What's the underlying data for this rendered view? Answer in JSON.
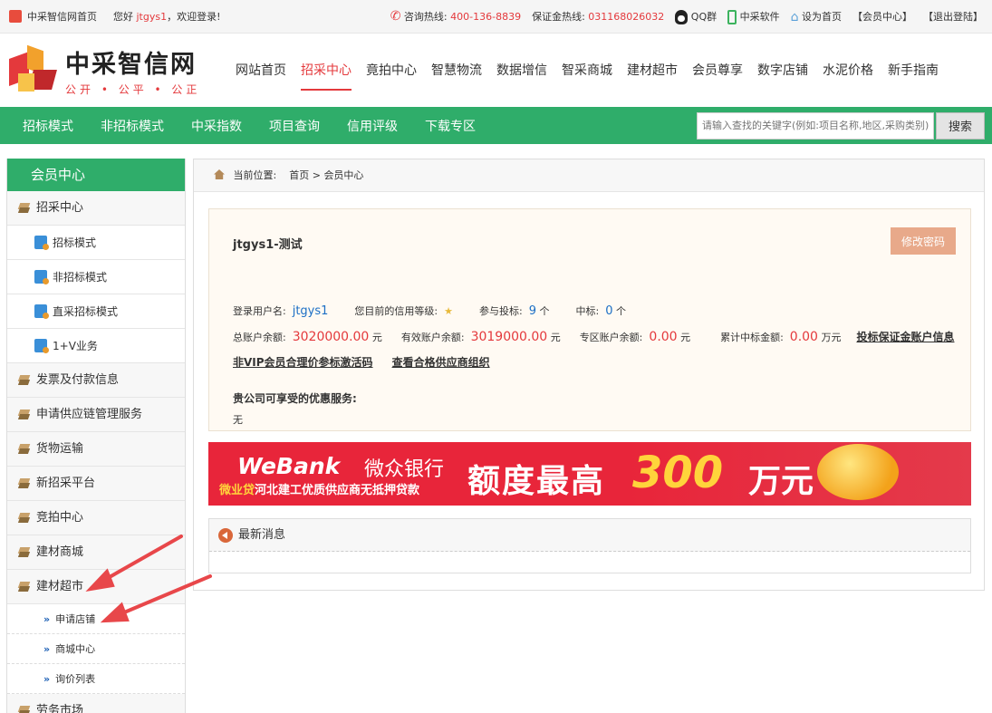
{
  "topbar": {
    "site_home": "中采智信网首页",
    "greet_prefix": "您好",
    "username": "jtgys1",
    "greet_suffix": "，欢迎登录!",
    "hotline_label": "咨询热线:",
    "hotline": "400-136-8839",
    "deposit_label": "保证金热线:",
    "deposit_phone": "031168026032",
    "qq": "QQ群",
    "software": "中采软件",
    "set_home": "设为首页",
    "member_center": "【会员中心】",
    "logout": "【退出登陆】"
  },
  "logo": {
    "name": "中采智信网",
    "slogan": "公开 • 公平 • 公正"
  },
  "mainnav": [
    "网站首页",
    "招采中心",
    "竟拍中心",
    "智慧物流",
    "数据增信",
    "智采商城",
    "建材超市",
    "会员尊享",
    "数字店铺",
    "水泥价格",
    "新手指南"
  ],
  "mainnav_active": "招采中心",
  "subnav": [
    "招标模式",
    "非招标模式",
    "中采指数",
    "项目查询",
    "信用评级",
    "下载专区"
  ],
  "search": {
    "placeholder": "请输入查找的关键字(例如:项目名称,地区,采购类别)",
    "button": "搜索"
  },
  "sidebar": {
    "title": "会员中心",
    "items": [
      {
        "type": "cat",
        "label": "招采中心"
      },
      {
        "type": "sub",
        "label": "招标模式"
      },
      {
        "type": "sub",
        "label": "非招标模式"
      },
      {
        "type": "sub",
        "label": "直采招标模式"
      },
      {
        "type": "sub",
        "label": "1+V业务"
      },
      {
        "type": "cat",
        "label": "发票及付款信息"
      },
      {
        "type": "cat",
        "label": "申请供应链管理服务"
      },
      {
        "type": "cat",
        "label": "货物运输"
      },
      {
        "type": "cat",
        "label": "新招采平台"
      },
      {
        "type": "cat",
        "label": "竞拍中心"
      },
      {
        "type": "cat",
        "label": "建材商城"
      },
      {
        "type": "cat",
        "label": "建材超市"
      },
      {
        "type": "sub2",
        "label": "申请店铺"
      },
      {
        "type": "sub2",
        "label": "商城中心"
      },
      {
        "type": "sub2",
        "label": "询价列表"
      },
      {
        "type": "cat",
        "label": "劳务市场"
      }
    ]
  },
  "breadcrumb": {
    "label": "当前位置:",
    "home": "首页",
    "sep": ">",
    "current": "会员中心"
  },
  "account": {
    "title": "jtgys1-测试",
    "change_password": "修改密码",
    "login_user_label": "登录用户名:",
    "login_user": "jtgys1",
    "credit_label": "您目前的信用等级:",
    "credit_stars": "★",
    "bids_label": "参与投标:",
    "bids": "9",
    "bids_unit": "个",
    "wins_label": "中标:",
    "wins": "0",
    "wins_unit": "个",
    "total_label": "总账户余额:",
    "total": "3020000.00",
    "total_unit": "元",
    "valid_label": "有效账户余额:",
    "valid": "3019000.00",
    "valid_unit": "元",
    "zone_label": "专区账户余额:",
    "zone": "0.00",
    "zone_unit": "元",
    "acc_win_label": "累计中标金额:",
    "acc_win": "0.00",
    "acc_win_unit": "万元",
    "deposit_link": "投标保证金账户信息",
    "nonvip_link": "非VIP会员合理价参标激活码",
    "suppliers_link": "查看合格供应商组织",
    "offers_title": "贵公司可享受的优惠服务:",
    "offers_value": "无"
  },
  "banner": {
    "brand": "WeBank",
    "brand_cn": "微众银行",
    "product": "微业贷",
    "desc": "河北建工优质供应商无抵押贷款",
    "headline": "额度最高",
    "amount": "300",
    "unit": "万元"
  },
  "news": {
    "title": "最新消息"
  }
}
